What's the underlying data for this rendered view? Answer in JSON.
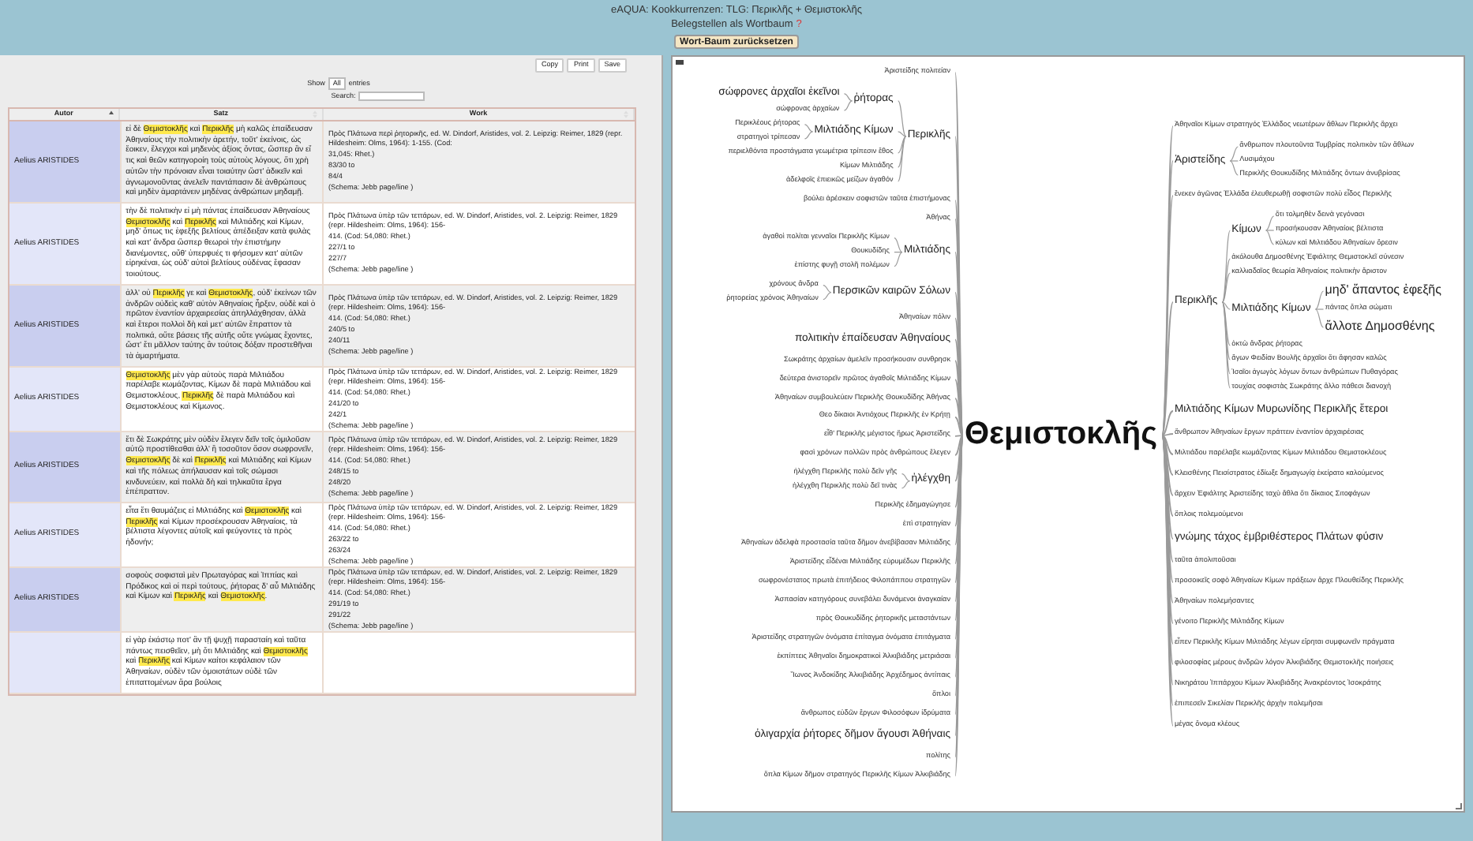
{
  "header": {
    "title": "eAQUA: Kookkurrenzen: TLG: Περικλῆς + Θεμιστοκλῆς",
    "subtitle": "Belegstellen als Wortbaum",
    "help": "?",
    "reset_button": "Wort-Baum zurücksetzen"
  },
  "table_panel": {
    "buttons": [
      "Copy",
      "Print",
      "Save"
    ],
    "show_before": "Show",
    "show_value": "All",
    "show_after": "entries",
    "search_label": "Search:",
    "columns": [
      {
        "label": "Autor",
        "sorted": true
      },
      {
        "label": "Satz",
        "sorted": false
      },
      {
        "label": "Work",
        "sorted": false
      }
    ],
    "rows": [
      {
        "author": "Aelius ARISTIDES",
        "sentence": "εἰ δὲ **Θεμιστοκλῆς** καὶ **Περικλῆς** μὴ καλῶς ἐπαίδευσαν Ἀθηναίους τὴν πολιτικὴν ἀρετήν, τοῦτ' ἐκείνοις, ὡς ἔοικεν, ἔλεγχοι καὶ μηδενὸς ἀξίοις ὄντας, ὥσπερ ἂν εἴ τις καὶ θεῶν κατηγοροίη τοὺς αὐτοὺς λόγους, ὅτι χρὴ αὐτῶν τὴν πρόνοιαν εἶναι τοιαύτην ὥστ' ἀδικεῖν καὶ ἀγνωμονοῦντας ἀνελεῖν παντάπασιν δὲ ἀνθρώπους καὶ μηδὲν ἁμαρτάνειν μηδένας ἀνθρώπων μηδαμῇ.",
        "work": [
          "Πρὸς Πλάτωνα περὶ ῥητορικῆς, ed. W. Dindorf, Aristides, vol. 2. Leipzig: Reimer, 1829 (repr. Hildesheim: Olms, 1964): 1-155. (Cod:",
          "31,045: Rhet.)",
          "83/30 to",
          "84/4",
          "(Schema: Jebb page/line )"
        ]
      },
      {
        "author": "Aelius ARISTIDES",
        "sentence": "τὴν δὲ πολιτικὴν εἰ μὴ πάντας ἐπαίδευσαν Ἀθηναίους **Θεμιστοκλῆς** καὶ **Περικλῆς** καὶ Μιλτιάδης καὶ Κίμων, μηδ' ὅπως τις ἐφεξῆς βελτίους ἀπέδειξαν κατὰ φυλὰς καὶ κατ' ἄνδρα ὥσπερ θεωροὶ τὴν ἐπιστήμην διανέμοντες, οὔθ' ὑπερφυές τι φήσομεν κατ' αὐτῶν εἰρηκέναι, ὡς οὐδ' αὐτοὶ βελτίους οὐδένας ἔφασαν τοιούτους.",
        "work": [
          "Πρὸς Πλάτωνα ὑπὲρ τῶν τεττάρων, ed. W. Dindorf, Aristides, vol. 2. Leipzig: Reimer, 1829 (repr. Hildesheim: Olms, 1964): 156-",
          "414. (Cod: 54,080: Rhet.)",
          "227/1 to",
          "227/7",
          "(Schema: Jebb page/line )"
        ]
      },
      {
        "author": "Aelius ARISTIDES",
        "sentence": "ἀλλ' οὐ **Περικλῆς** γε καὶ **Θεμιστοκλῆς**, οὐδ' ἐκείνων τῶν ἀνδρῶν οὐδεὶς καθ' αὑτὸν Ἀθηναίοις ἦρξεν, οὐδὲ καὶ ὁ πρῶτον ἐναντίον ἀρχαιρεσίας ἀπηλλάχθησαν, ἀλλὰ καὶ ἕτεροι πολλοὶ δὴ καὶ μετ' αὐτῶν ἔπραττον τὰ πολιτικά, οὔτε βάσεις τῆς αὐτῆς οὔτε γνώμας ἔχοντες, ὥστ' ἔτι μᾶλλον ταύτης ἂν τούτοις δόξαν προστεθῆναι τὰ ἁμαρτήματα.",
        "work": [
          "Πρὸς Πλάτωνα ὑπὲρ τῶν τεττάρων, ed. W. Dindorf, Aristides, vol. 2. Leipzig: Reimer, 1829 (repr. Hildesheim: Olms, 1964): 156-",
          "414. (Cod: 54,080: Rhet.)",
          "240/5 to",
          "240/11",
          "(Schema: Jebb page/line )"
        ]
      },
      {
        "author": "Aelius ARISTIDES",
        "sentence": "**Θεμιστοκλῆς** μὲν γὰρ αὐτοὺς παρὰ Μιλτιάδου παρέλαβε κωμάζοντας, Κίμων δὲ παρὰ Μιλτιάδου καὶ Θεμιστοκλέους, **Περικλῆς** δὲ παρὰ Μιλτιάδου καὶ Θεμιστοκλέους καὶ Κίμωνος.",
        "work": [
          "Πρὸς Πλάτωνα ὑπὲρ τῶν τεττάρων, ed. W. Dindorf, Aristides, vol. 2. Leipzig: Reimer, 1829 (repr. Hildesheim: Olms, 1964): 156-",
          "414. (Cod: 54,080: Rhet.)",
          "241/20 to",
          "242/1",
          "(Schema: Jebb page/line )"
        ]
      },
      {
        "author": "Aelius ARISTIDES",
        "sentence": "ἔτι δὲ Σωκράτης μὲν οὐδὲν ἔλεγεν δεῖν τοῖς ὁμιλοῦσιν αὐτῷ προστίθεσθαι ἀλλ' ἢ τοσοῦτον ὅσον σωφρονεῖν, **Θεμιστοκλῆς** δὲ καὶ **Περικλῆς** καὶ Μιλτιάδης καὶ Κίμων καὶ τῆς πόλεως ἀπήλαυσαν καὶ τοῖς σώμασι κινδυνεύειν, καὶ πολλὰ δὴ καὶ τηλικαῦτα ἔργα ἐπέπραττον.",
        "work": [
          "Πρὸς Πλάτωνα ὑπὲρ τῶν τεττάρων, ed. W. Dindorf, Aristides, vol. 2. Leipzig: Reimer, 1829 (repr. Hildesheim: Olms, 1964): 156-",
          "414. (Cod: 54,080: Rhet.)",
          "248/15 to",
          "248/20",
          "(Schema: Jebb page/line )"
        ]
      },
      {
        "author": "Aelius ARISTIDES",
        "sentence": "εἶτα ἔτι θαυμάζεις εἰ Μιλτιάδης καὶ **Θεμιστοκλῆς** καὶ **Περικλῆς** καὶ Κίμων προσέκρουσαν Ἀθηναίοις, τὰ βέλτιστα λέγοντες αὐτοῖς καὶ φεύγοντες τὰ πρὸς ἡδονήν;",
        "work": [
          "Πρὸς Πλάτωνα ὑπὲρ τῶν τεττάρων, ed. W. Dindorf, Aristides, vol. 2. Leipzig: Reimer, 1829 (repr. Hildesheim: Olms, 1964): 156-",
          "414. (Cod: 54,080: Rhet.)",
          "263/22 to",
          "263/24",
          "(Schema: Jebb page/line )"
        ]
      },
      {
        "author": "Aelius ARISTIDES",
        "sentence": "σοφοὺς σοφισταὶ μὲν Πρωταγόρας καὶ Ἱππίας καὶ Πρόδικος καὶ οἱ περὶ τούτους, ῥήτορας δ' αὖ Μιλτιάδης καὶ Κίμων καὶ **Περικλῆς** καὶ **Θεμιστοκλῆς**.",
        "work": [
          "Πρὸς Πλάτωνα ὑπὲρ τῶν τεττάρων, ed. W. Dindorf, Aristides, vol. 2. Leipzig: Reimer, 1829 (repr. Hildesheim: Olms, 1964): 156-",
          "414. (Cod: 54,080: Rhet.)",
          "291/19 to",
          "291/22",
          "(Schema: Jebb page/line )"
        ]
      },
      {
        "sentence": "εἰ γὰρ ἑκάστῳ ποτ' ἂν τῇ ψυχῇ παρασταίη καὶ ταῦτα πάντως πεισθεῖεν, μὴ ὅτι Μιλτιάδης καὶ **Θεμιστοκλῆς** καὶ **Περικλῆς** καὶ Κίμων καίτοι κεφάλαιον τῶν Ἀθηναίων, οὐδὲν τῶν ὁμοιοτάτων οὐδὲ τῶν ἐπιταττομένων ἄρα βούλοις"
      }
    ]
  },
  "word_tree": {
    "root": "Θεμιστοκλῆς",
    "left": [
      {
        "label": "Ἀριστείδης πολιτείαν",
        "kind": "small"
      },
      {
        "label": "Περικλῆς",
        "kind": "medium",
        "children": [
          {
            "label": "ῥήτορας",
            "kind": "medium",
            "children": [
              {
                "label": "σώφρονες ἀρχαῖοι ἐκεῖνοι",
                "kind": "medium"
              },
              {
                "label": "σώφρονας ἀρχαίων",
                "kind": "small"
              }
            ]
          },
          {
            "label": "Μιλτιάδης Κίμων",
            "kind": "medium",
            "children": [
              {
                "label": "Περικλέους ῥήτορας",
                "kind": "small"
              },
              {
                "label": "στρατηγοὶ τρίπεσαν",
                "kind": "small"
              }
            ]
          },
          {
            "label": "περιελθόντα προστάγματα γεωμέτρια τρίπεσιν ἔθος",
            "kind": "small"
          },
          {
            "label": "Κίμων Μιλτιάδης",
            "kind": "small"
          },
          {
            "label": "ἀδελφοῖς ἐπιεικῶς μείζων ἀγαθόν",
            "kind": "small"
          }
        ]
      },
      {
        "label": "βούλει ἀρέσκειν σοφιστῶν ταῦτα ἐπιστήμονας",
        "kind": "small"
      },
      {
        "label": "Ἀθήνας",
        "kind": "small"
      },
      {
        "label": "Μιλτιάδης",
        "kind": "medium",
        "children": [
          {
            "label": "ἀγαθοὶ πολίται γενναῖοι Περικλῆς Κίμων",
            "kind": "small"
          },
          {
            "label": "Θουκυδίδης",
            "kind": "small"
          },
          {
            "label": "ἐπίστης φυγῇ στολῆ πολέμων",
            "kind": "small"
          }
        ]
      },
      {
        "label": "Περσικῶν καιρῶν Σόλων",
        "kind": "medium",
        "children": [
          {
            "label": "χρόνους ἄνδρα",
            "kind": "small"
          },
          {
            "label": "ῥητορείας χρόνοις Ἀθηναίων",
            "kind": "small"
          }
        ]
      },
      {
        "label": "Ἀθηναίων πόλιν",
        "kind": "small"
      },
      {
        "label": "πολιτικὴν ἐπαίδευσαν Ἀθηναίους",
        "kind": "medium"
      },
      {
        "label": "Σωκράτης ἀρχαίων ἀμελεῖν προσήκουσιν συνθρησκ",
        "kind": "small"
      },
      {
        "label": "δεύτερα ἀνιστορεῖν πρῶτος ἀγαθοῖς Μιλτιάδης Κίμων",
        "kind": "small"
      },
      {
        "label": "Ἀθηναίων συμβουλεύειν Περικλῆς Θουκυδίδης Ἀθήνας",
        "kind": "small"
      },
      {
        "label": "Θεο δίκαιοι Ἀντιόχους Περικλῆς ἐν Κρήτῃ",
        "kind": "small"
      },
      {
        "label": "εἶθ' Περικλῆς μέγιστος ἥρως Ἀριστείδης",
        "kind": "small"
      },
      {
        "label": "φασὶ χρόνων πολλῶν πρὸς ἀνθρώπους ἔλεγεν",
        "kind": "small"
      },
      {
        "label": "ἠλέγχθη",
        "kind": "medium",
        "children": [
          {
            "label": "ἠλέγχθη Περικλῆς πολὺ δεῖν γῆς",
            "kind": "small"
          },
          {
            "label": "ἠλέγχθη Περικλῆς πολὺ δεῖ τινὰς",
            "kind": "small"
          }
        ]
      },
      {
        "label": "Περικλῆς ἐδημαγώγησε",
        "kind": "small"
      },
      {
        "label": "ἐπὶ στρατηγίαν",
        "kind": "small"
      },
      {
        "label": "Ἀθηναίων ἀδελφὰ προστασία ταῦτα δῆμον ἀνεβίβασαν Μιλτιάδης",
        "kind": "small"
      },
      {
        "label": "Ἀριστείδης εἶδέναι Μιλτιάδης εὐρυμέδων Περικλῆς",
        "kind": "small"
      },
      {
        "label": "σωφρονέστατος πρωτὰ ἐπιτήδειος Φιλοπάππου στρατηγῶν",
        "kind": "small"
      },
      {
        "label": "Ἀσπασίαν κατηγόρους συνεβάλει δυνάμενοι ἀναγκαίαν",
        "kind": "small"
      },
      {
        "label": "πρὸς Θουκυδίδης ῥητορικῆς μεταστάντων",
        "kind": "small"
      },
      {
        "label": "Ἀριστείδης στρατηγῶν ὀνόματα ἐπίταγμα ὀνόματα ἐπιτάγματα",
        "kind": "small"
      },
      {
        "label": "ἐκπίπτεις Ἀθηναῖοι δημοκρατικοὶ Ἀλκιβιάδης μετριάσαι",
        "kind": "small"
      },
      {
        "label": "Ἴωνος Ἀνδοκίδης Ἀλκιβιάδης Ἀρχέδημος ἀντίπαις",
        "kind": "small"
      },
      {
        "label": "ὅπλοι",
        "kind": "small"
      },
      {
        "label": "ἄνθρωπος εὐδῶν ἔργων Φιλοσόφων ἰδρύματα",
        "kind": "small"
      },
      {
        "label": "ὀλιγαρχία ῥήτορες δῆμον ἄγουσι Ἀθήναις",
        "kind": "medium"
      },
      {
        "label": "πολίτης",
        "kind": "small"
      },
      {
        "label": "ὅπλα Κίμων δῆμον στρατηγός Περικλῆς Κίμων Ἀλκιβιάδης",
        "kind": "small"
      }
    ],
    "right": [
      {
        "label": "Ἀθηναῖοι Κίμων στρατηγός Ἑλλάδος νεωτέρων ἄθλων Περικλῆς ἄρχει",
        "kind": "small"
      },
      {
        "label": "Ἀριστείδης",
        "kind": "medium",
        "children": [
          {
            "label": "ἄνθρωπον πλουτοῦντα Τυμβρίας πολιτικὸν τῶν ἄθλων",
            "kind": "small"
          },
          {
            "label": "Λυσιμάχου",
            "kind": "small"
          },
          {
            "label": "Περικλῆς Θουκυδίδης Μιλτιάδης ὄντων ἀνυβρίσας",
            "kind": "small"
          }
        ]
      },
      {
        "label": "ἕνεκεν ἀγῶνας Ἑλλάδα ἐλευθερωθῇ σοφιστῶν πολὺ εἶδος Περικλῆς",
        "kind": "small"
      },
      {
        "label": "Περικλῆς",
        "kind": "medium",
        "children": [
          {
            "label": "Κίμων",
            "kind": "medium",
            "children": [
              {
                "label": "ὅτι τολμηθὲν δεινὰ γεγόνασι",
                "kind": "small"
              },
              {
                "label": "προσήκουσαν Ἀθηναίοις βέλτιστα",
                "kind": "small"
              },
              {
                "label": "κύλων καὶ Μιλτιάδου Ἀθηναίων ὄρεσιν",
                "kind": "small"
              }
            ]
          },
          {
            "label": "ἀκόλουθα Δημοσθένης Ἐφιάλτης Θεμιστοκλεῖ σύνεσιν",
            "kind": "small"
          },
          {
            "label": "καλλιαδαῖος θεωρία Ἀθηναίοις πολιτικὴν ἄριστον",
            "kind": "small"
          },
          {
            "label": "Μιλτιάδης Κίμων",
            "kind": "medium",
            "children": [
              {
                "label": "μηδ' ἄπαντος ἐφεξῆς",
                "kind": "large"
              },
              {
                "label": "πάντας ὅπλα σώματι",
                "kind": "small"
              },
              {
                "label": "ἄλλοτε Δημοσθένης",
                "kind": "large"
              }
            ]
          },
          {
            "label": "ὀκτὼ ἄνδρας ῥήτορας",
            "kind": "small"
          },
          {
            "label": "ἄγων Φειδίαν Βουλῆς ἀρχαῖοι ὅτι ἄφησαν καλῶς",
            "kind": "small"
          },
          {
            "label": "Ἰσαῖοι ἀγωγὸς λόγων ὄντων ἀνθρώπων Πυθαγόρας",
            "kind": "small"
          },
          {
            "label": "τουχίας σοφιστὰς Σωκράτης ἄλλο πάθεσι διανοχὴ",
            "kind": "small"
          }
        ]
      },
      {
        "label": "Μιλτιάδης Κίμων Μυρωνίδης Περικλῆς ἕτεροι",
        "kind": "medium"
      },
      {
        "label": "ἄνθρωπον Ἀθηναίων ἔργων πράττειν ἐναντίον ἀρχαιρέσιας",
        "kind": "small"
      },
      {
        "label": "Μιλτιάδου παρέλαβε κωμάζοντας Κίμων Μιλτιάδου Θεμιστοκλέους",
        "kind": "small"
      },
      {
        "label": "Κλεισθένης Πεισίστρατος ἐδίωξε δημαγωγίᾳ ἐκείρατο καλούμενος",
        "kind": "small"
      },
      {
        "label": "ἄρχειν Ἐφιάλτης Ἀριστείδης ταχὺ ἄθλα ὅτι δίκαιος Σιτοφάγων",
        "kind": "small"
      },
      {
        "label": "ὅπλοις πολεμούμενοι",
        "kind": "small"
      },
      {
        "label": "γνώμης τάχος ἐμβριθέστερος Πλάτων φύσιν",
        "kind": "medium"
      },
      {
        "label": "ταῦτα ἀπολιποῦσαι",
        "kind": "small"
      },
      {
        "label": "προσοικεῖς σοφὸ Ἀθηναίων Κίμων πράξεων ἄρχε Πλουθείδης Περικλῆς",
        "kind": "small"
      },
      {
        "label": "Ἀθηναίων πολεμήσαντες",
        "kind": "small"
      },
      {
        "label": "γένοιτο Περικλῆς Μιλτιάδης Κίμων",
        "kind": "small"
      },
      {
        "label": "εἶπεν Περικλῆς Κίμων Μιλτιάδης λέγων εἴρηται συμφωνεῖν πράγματα",
        "kind": "small"
      },
      {
        "label": "φιλοσοφίας μέρους ἀνδρῶν λόγον Ἀλκιβιάδης Θεμιστοκλῆς ποιήσεις",
        "kind": "small"
      },
      {
        "label": "Νικηράτου Ἱππάρχου Κίμων Ἀλκιβιάδης Ἀνακρέοντος Ἰσοκράτης",
        "kind": "small"
      },
      {
        "label": "ἐπιπεσεῖν Σικελίαν Περικλῆς ἀρχὴν πολεμῆσαι",
        "kind": "small"
      },
      {
        "label": "μέγας ὄνομα κλέους",
        "kind": "small"
      }
    ]
  }
}
